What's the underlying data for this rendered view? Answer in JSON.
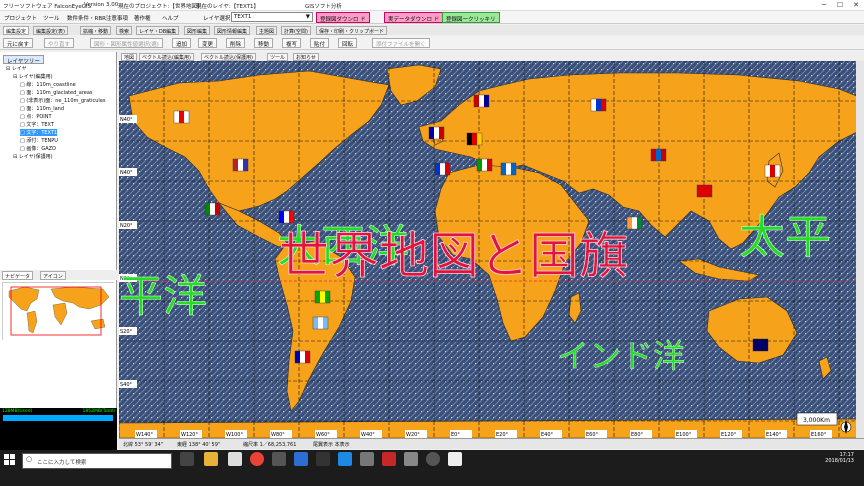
{
  "window": {
    "app_name": "フリーソフトウェア FalconEyeGIS",
    "version": "Version 3.00",
    "project": "現在のプロジェクト:【世界地図】",
    "layer": "現在のレイヤ:【TEXT1】",
    "brand": "GISソフト分析"
  },
  "menu": {
    "items": [
      "プロジェクト",
      "ツール",
      "数件条件・RBR注意事項",
      "著作権",
      "ヘルプ"
    ],
    "layer_select_label": "レイヤ選択",
    "layer_select_value": "TEXT1",
    "btn_download": "登録図ダウンロ ド",
    "btn_shapefile": "実データダウンロ ド",
    "btn_clear": "登録図ークリッキリ"
  },
  "tabs": [
    "編集設定",
    "編集設定(表)",
    "拡縮・移動",
    "検索",
    "レイヤ・DB編集",
    "図形編集",
    "図形情報編集",
    "主題図",
    "計算(空間)",
    "保存・印刷・クリップボード"
  ],
  "toolbar": {
    "btn_undo": "元に戻す",
    "btn_redo": "やり直す",
    "btn_info_select": "図形・図形属性値選択(選)",
    "btn_add": "追加",
    "btn_change": "変更",
    "btn_delete": "削除",
    "btn_move": "移動",
    "btn_copy": "複写",
    "btn_paste": "貼付",
    "btn_rotate": "回転",
    "btn_file_open": "添付ファイルを開く"
  },
  "sidebar": {
    "tab_label": "レイヤツリー",
    "tree": [
      {
        "label": "レイヤ",
        "indent": 0,
        "selected": false
      },
      {
        "label": "レイヤ(編集用)",
        "indent": 1,
        "selected": false
      },
      {
        "label": "線：110m_coastline",
        "indent": 2,
        "selected": false
      },
      {
        "label": "面：110m_glaciated_areas",
        "indent": 2,
        "selected": false
      },
      {
        "label": "(非表示)面：ne_110m_graticules",
        "indent": 2,
        "selected": false
      },
      {
        "label": "面：110m_land",
        "indent": 2,
        "selected": false
      },
      {
        "label": "点：POINT",
        "indent": 2,
        "selected": false
      },
      {
        "label": "文字：TEXT",
        "indent": 2,
        "selected": false
      },
      {
        "label": "文字：TEXT1",
        "indent": 2,
        "selected": true
      },
      {
        "label": "添付：TENPU",
        "indent": 2,
        "selected": false
      },
      {
        "label": "画像：GAZO",
        "indent": 2,
        "selected": false
      },
      {
        "label": "レイヤ(保護用)",
        "indent": 1,
        "selected": false
      }
    ],
    "nav_tab": "ナビゲータ",
    "icon_tab": "アイコン",
    "memory_left": "128MB(Used)",
    "memory_right": "1852MB(Total)"
  },
  "map_tabs": [
    "地図",
    "ベクトル読込(編集用)",
    "ベクトル読込(保護用)",
    "ツール",
    "お知らせ"
  ],
  "map": {
    "title_text": "世界地図と国旗",
    "labels": {
      "atlantic": "大西洋",
      "pacific_left": "平洋",
      "pacific_right": "太平",
      "indian": "インド洋"
    },
    "lat_labels": [
      "N40°",
      "N40°",
      "N20°",
      "N0°",
      "S20°",
      "S40°"
    ],
    "lon_labels": [
      "W140°",
      "W120°",
      "W100°",
      "W80°",
      "W60°",
      "W40°",
      "W20°",
      "E0°",
      "E20°",
      "E40°",
      "E60°",
      "E80°",
      "E100°",
      "E120°",
      "E140°",
      "E160°"
    ],
    "scale_label": "3,000Km",
    "colors": {
      "ocean": "#3a4f78",
      "land": "#f7a21b",
      "title": "#e0143c",
      "labels": "#22dd22"
    }
  },
  "status": {
    "lat": "北緯  53° 59' 34\"",
    "lon": "東経  138° 40' 59\"",
    "scale": "縮尺率  1／68,253,761",
    "mode": "尾翼表示 本表示"
  },
  "taskbar": {
    "search_placeholder": "ここに入力して検索",
    "time": "17:17",
    "date": "2018/01/13"
  }
}
